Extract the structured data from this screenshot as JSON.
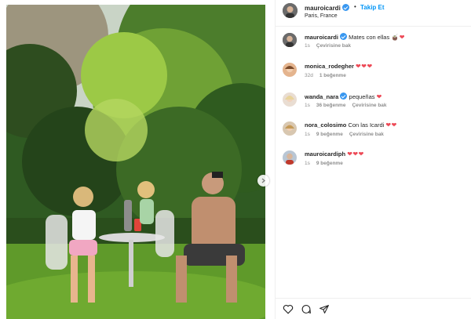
{
  "post": {
    "username": "mauroicardi",
    "follow_label": "Takip Et",
    "separator": "•",
    "location": "Paris, France"
  },
  "comments": [
    {
      "username": "mauroicardi",
      "text": " Mates con ellas ",
      "emoji": "🧉❤",
      "time": "1s",
      "likes": "",
      "translate": "Çevirisine bak",
      "verified": true
    },
    {
      "username": "monica_rodegher",
      "text": " ",
      "emoji": "❤❤❤",
      "time": "32d",
      "likes": "1 beğenme",
      "translate": "",
      "verified": false
    },
    {
      "username": "wanda_nara",
      "text": " pequeñas ",
      "emoji": "❤",
      "time": "1s",
      "likes": "36 beğenme",
      "translate": "Çevirisine bak",
      "verified": true
    },
    {
      "username": "nora_colosimo",
      "text": " Con las Icardi ",
      "emoji": "❤❤",
      "time": "1s",
      "likes": "9 beğenme",
      "translate": "Çevirisine bak",
      "verified": false
    },
    {
      "username": "mauroicardiph",
      "text": " ",
      "emoji": "❤❤❤",
      "time": "1s",
      "likes": "9 beğenme",
      "translate": "",
      "verified": false
    }
  ],
  "actions": {
    "like_icon": "heart-outline-icon",
    "comment_icon": "speech-bubble-icon",
    "share_icon": "paper-plane-icon"
  },
  "colors": {
    "link_blue": "#0095f6",
    "verified_blue": "#3897f0",
    "heart_red": "#ed4956",
    "meta_gray": "#8e8e8e"
  }
}
